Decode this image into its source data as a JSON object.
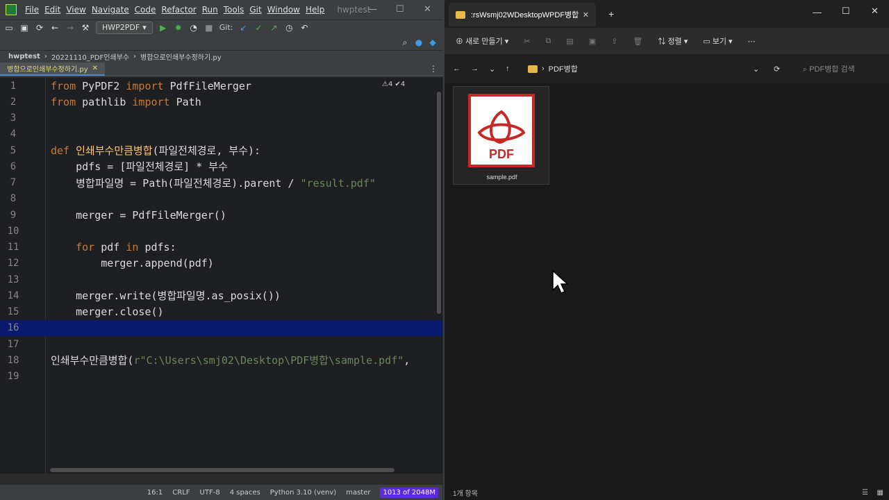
{
  "ide": {
    "menu": [
      "File",
      "Edit",
      "View",
      "Navigate",
      "Code",
      "Refactor",
      "Run",
      "Tools",
      "Git",
      "Window",
      "Help"
    ],
    "project_title": "hwptest",
    "run_config": "HWP2PDF",
    "git_label": "Git:",
    "breadcrumb": [
      "hwptest",
      "20221110_PDF인쇄부수",
      "병합으로인쇄부수정하기.py"
    ],
    "tab": "병합으로인쇄부수정하기.py",
    "inspections": "⚠4  ✔4",
    "lines": [
      {
        "n": "1",
        "html": "<span class='kw'>from</span> PyPDF2 <span class='kw'>import</span> PdfFileMerger"
      },
      {
        "n": "2",
        "html": "<span class='kw'>from</span> pathlib <span class='kw'>import</span> Path"
      },
      {
        "n": "3",
        "html": ""
      },
      {
        "n": "4",
        "html": ""
      },
      {
        "n": "5",
        "html": "<span class='kw'>def</span> <span class='fn'>인쇄부수만큼병합</span>(파일전체경로, 부수):"
      },
      {
        "n": "6",
        "html": "    pdfs = [파일전체경로] * 부수"
      },
      {
        "n": "7",
        "html": "    병합파일명 = Path(파일전체경로).parent / <span class='str'>\"result.pdf\"</span>"
      },
      {
        "n": "8",
        "html": ""
      },
      {
        "n": "9",
        "html": "    merger = PdfFileMerger()"
      },
      {
        "n": "10",
        "html": ""
      },
      {
        "n": "11",
        "html": "    <span class='kw'>for</span> pdf <span class='kw'>in</span> pdfs:"
      },
      {
        "n": "12",
        "html": "        merger.append(pdf)"
      },
      {
        "n": "13",
        "html": ""
      },
      {
        "n": "14",
        "html": "    merger.write(병합파일명.as_posix())"
      },
      {
        "n": "15",
        "html": "    merger.close()"
      },
      {
        "n": "16",
        "html": ""
      },
      {
        "n": "17",
        "html": ""
      },
      {
        "n": "18",
        "html": "인쇄부수만큼병합(<span class='str'>r\"C:\\Users\\smj02\\Desktop\\PDF병합\\sample.pdf\"</span>,"
      },
      {
        "n": "19",
        "html": ""
      }
    ],
    "status": {
      "pos": "16:1",
      "eol": "CRLF",
      "enc": "UTF-8",
      "indent": "4 spaces",
      "interp": "Python 3.10 (venv)",
      "branch": "master",
      "memory": "1013 of 2048M"
    }
  },
  "explorer": {
    "tab_title": ":rsWsmj02WDesktopWPDF병합",
    "commands": [
      "새로 만들기",
      "정렬",
      "보기"
    ],
    "path": [
      "PDF병합"
    ],
    "search_placeholder": "PDF병합 검색",
    "file": {
      "name": "sample.pdf",
      "badge": "PDF"
    },
    "status": "1개 항목"
  },
  "colors": {
    "accent": "#4a88c7",
    "pdf_red": "#c62828",
    "memory": "#5a2bd6"
  }
}
